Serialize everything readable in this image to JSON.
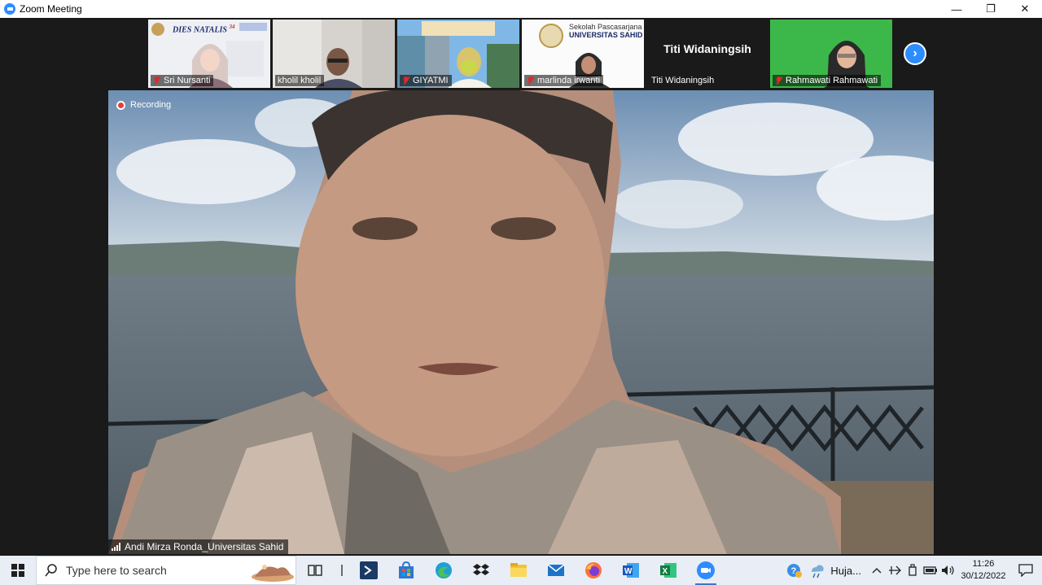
{
  "window": {
    "title": "Zoom Meeting",
    "minimize": "—",
    "restore": "❐",
    "close": "✕"
  },
  "gallery": {
    "participants": [
      {
        "name": "Sri Nursanti",
        "muted": true,
        "poster_title": "DIES NATALIS",
        "poster_number": "34"
      },
      {
        "name": "kholil kholil",
        "muted": false
      },
      {
        "name": "GIYATMI",
        "muted": true
      },
      {
        "name": "marlinda irwanti",
        "muted": true,
        "poster_line1": "Sekolah Pascasarjana",
        "poster_line2": "UNIVERSITAS SAHID"
      },
      {
        "name": "Titi Widaningsih",
        "muted": false,
        "display_name_big": "Titi Widaningsih"
      },
      {
        "name": "Rahmawati Rahmawati",
        "muted": true
      }
    ],
    "next_button": "›"
  },
  "main_video": {
    "recording_label": "Recording",
    "speaker_name": "Andi Mirza Ronda_Universitas Sahid"
  },
  "taskbar": {
    "search_placeholder": "Type here to search",
    "weather_text": "Huja...",
    "time": "11:26",
    "date": "30/12/2022",
    "accent": "#3a78c9"
  }
}
